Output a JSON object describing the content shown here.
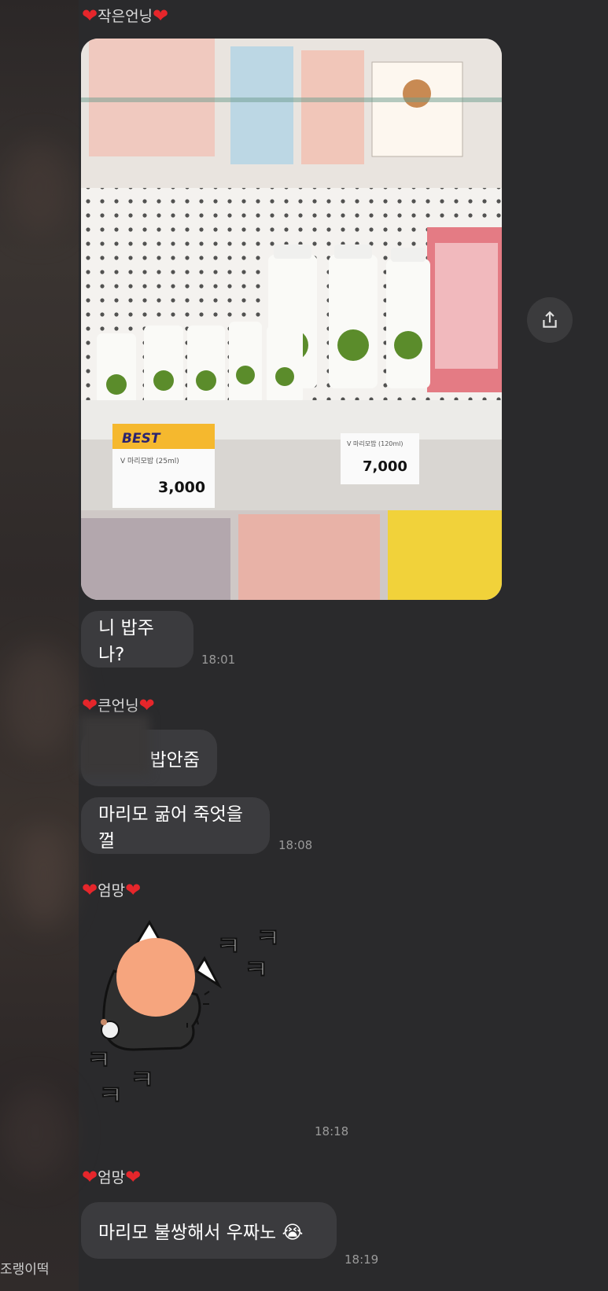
{
  "messages": [
    {
      "sender": "작은언닝",
      "type": "photo"
    },
    {
      "text": "니 밥주나?",
      "time": "18:01"
    },
    {
      "sender": "큰언닝",
      "text1": "밥안줌",
      "text2": "마리모 굶어 죽엇을껄",
      "time": "18:08"
    },
    {
      "sender": "엄망",
      "type": "sticker",
      "time": "18:18"
    },
    {
      "sender": "엄망",
      "text": "마리모 불쌍해서 우짜노 😭",
      "time": "18:19"
    }
  ],
  "photo": {
    "best_tag": "BEST",
    "price_small": "3,000",
    "price_large": "7,000",
    "product_name": "마리모밥",
    "small_label": "V 마리모밥 (25ml)",
    "large_label": "V 마리모밥 (120ml)"
  },
  "sticker": {
    "laugh_top": [
      "ㅋ",
      "ㅋ",
      "ㅋ"
    ],
    "laugh_bottom": [
      "ㅋ",
      "ㅋ",
      "ㅋ"
    ]
  },
  "bottom_label": "조랭이떡",
  "icons": {
    "share": "share-icon",
    "heart": "heart-icon"
  }
}
